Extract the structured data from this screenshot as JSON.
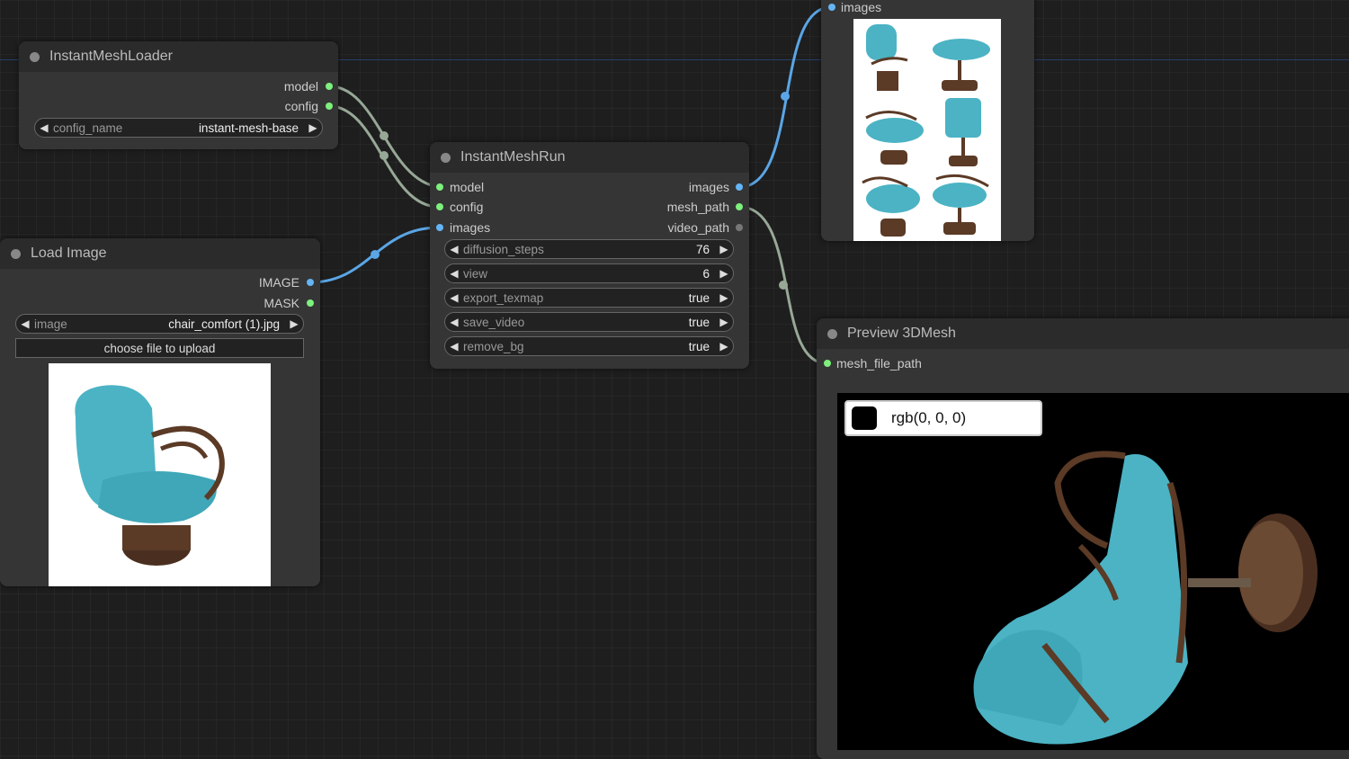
{
  "nodes": {
    "loader": {
      "title": "InstantMeshLoader",
      "outputs": [
        "model",
        "config"
      ],
      "widget": {
        "label": "config_name",
        "value": "instant-mesh-base"
      }
    },
    "run": {
      "title": "InstantMeshRun",
      "inputs": [
        "model",
        "config",
        "images"
      ],
      "outputs": [
        "images",
        "mesh_path",
        "video_path"
      ],
      "widgets": [
        {
          "label": "diffusion_steps",
          "value": "76"
        },
        {
          "label": "view",
          "value": "6"
        },
        {
          "label": "export_texmap",
          "value": "true"
        },
        {
          "label": "save_video",
          "value": "true"
        },
        {
          "label": "remove_bg",
          "value": "true"
        }
      ]
    },
    "load_image": {
      "title": "Load Image",
      "outputs": [
        "IMAGE",
        "MASK"
      ],
      "widget": {
        "label": "image",
        "value": "chair_comfort (1).jpg"
      },
      "upload_button": "choose file to upload"
    },
    "preview_images": {
      "inputs": [
        "images"
      ]
    },
    "preview_mesh": {
      "title": "Preview 3DMesh",
      "inputs": [
        "mesh_file_path"
      ],
      "bg_color_label": "rgb(0, 0, 0)"
    }
  },
  "icons": {
    "arrow_left": "◀",
    "arrow_right": "▶"
  },
  "colors": {
    "chair_cushion": "#4bb3c4",
    "chair_frame": "#5b3a26",
    "link_blue": "#5aa6e6",
    "link_gray": "#97a897"
  }
}
